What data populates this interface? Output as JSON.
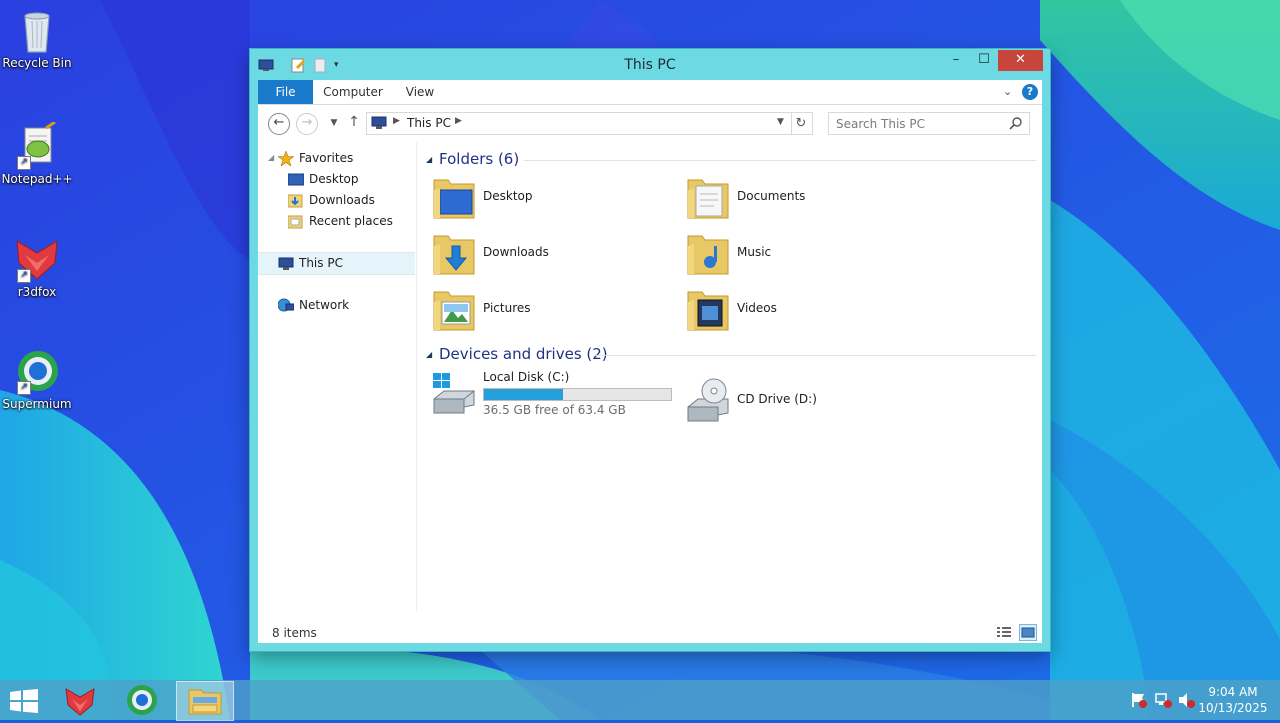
{
  "desktop": {
    "icons": [
      {
        "label": "Recycle Bin",
        "icon": "recycle-bin-icon"
      },
      {
        "label": "Notepad++",
        "icon": "notepad-plus-plus-icon"
      },
      {
        "label": "r3dfox",
        "icon": "r3dfox-icon"
      },
      {
        "label": "Supermium",
        "icon": "supermium-icon"
      }
    ]
  },
  "window": {
    "title": "This PC",
    "controls": {
      "minimize": "–",
      "maximize": "☐",
      "close": "✕"
    },
    "ribbon": {
      "tabs": [
        {
          "label": "File",
          "active": true
        },
        {
          "label": "Computer"
        },
        {
          "label": "View"
        }
      ],
      "help": "?"
    },
    "navigation": {
      "address": "This PC",
      "search_placeholder": "Search This PC"
    },
    "nav_pane": {
      "favorites": "Favorites",
      "favorites_items": [
        {
          "label": "Desktop",
          "icon": "desktop-folder-icon"
        },
        {
          "label": "Downloads",
          "icon": "downloads-folder-icon"
        },
        {
          "label": "Recent places",
          "icon": "recent-places-icon"
        }
      ],
      "this_pc": "This PC",
      "network": "Network"
    },
    "content": {
      "folders_header": "Folders (6)",
      "folders": [
        {
          "label": "Desktop",
          "icon": "desktop-folder-icon"
        },
        {
          "label": "Documents",
          "icon": "documents-folder-icon"
        },
        {
          "label": "Downloads",
          "icon": "downloads-folder-icon"
        },
        {
          "label": "Music",
          "icon": "music-folder-icon"
        },
        {
          "label": "Pictures",
          "icon": "pictures-folder-icon"
        },
        {
          "label": "Videos",
          "icon": "videos-folder-icon"
        }
      ],
      "drives_header": "Devices and drives (2)",
      "drives": [
        {
          "label": "Local Disk (C:)",
          "free_text": "36.5 GB free of 63.4 GB",
          "used_fraction": 0.424,
          "icon": "local-disk-icon"
        },
        {
          "label": "CD Drive (D:)",
          "icon": "cd-drive-icon"
        }
      ]
    },
    "status": {
      "item_count": "8 items"
    }
  },
  "taskbar": {
    "apps": [
      "r3dfox",
      "Supermium",
      "File Explorer"
    ],
    "time": "9:04 AM",
    "date": "10/13/2025"
  },
  "colors": {
    "accent": "#1979ca",
    "window_frame": "#6cd9e3",
    "close_button": "#c7453a",
    "drive_bar": "#26a0da"
  }
}
